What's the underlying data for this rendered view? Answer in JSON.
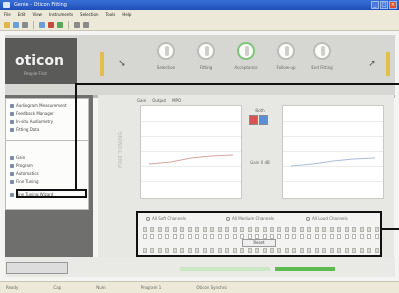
{
  "window": {
    "title": "Genie - Oticon Fitting",
    "controls": [
      "_",
      "□",
      "×"
    ]
  },
  "menu": [
    "File",
    "Edit",
    "View",
    "Instruments",
    "Selection",
    "Tools",
    "Help"
  ],
  "toolbar_icons": [
    "open-icon",
    "save-icon",
    "print-icon",
    "help-icon",
    "left-ear-icon",
    "right-ear-icon",
    "back-icon",
    "forward-icon"
  ],
  "brand": {
    "logo": "oticon",
    "tagline": "People First"
  },
  "steps": [
    {
      "label": "Selection",
      "active": false
    },
    {
      "label": "Fitting",
      "active": false
    },
    {
      "label": "Acceptance",
      "active": true
    },
    {
      "label": "Follow-up",
      "active": false
    },
    {
      "label": "End Fitting",
      "active": false
    }
  ],
  "sidebar": {
    "top_items": [
      "Audiogram Measurement",
      "Feedback Manager",
      "In-situ Audiometry",
      "Fitting Data"
    ],
    "bottom_items": [
      "Gain",
      "Program",
      "Automatics",
      "Fine Tuning",
      "Fine Tuning Wizard"
    ],
    "highlighted": "Fine Tuning Wizard"
  },
  "main": {
    "vertical_title": "FINE TUNING",
    "tabs": [
      "Gain",
      "Output",
      "MPO"
    ],
    "center_labels": [
      "R",
      "L",
      "Both",
      "Gain 0 dB"
    ]
  },
  "sliders": {
    "channels": [
      "All Soft Channels",
      "All Medium Channels",
      "All Loud Channels"
    ],
    "button": "Reset"
  },
  "status": [
    "Ready",
    "Cap",
    "Num",
    "Program 1",
    "Oticon Synchro"
  ],
  "colors": {
    "accent_green": "#5cba4e",
    "active_step": "#7fc47a",
    "right_ear": "#d9534f",
    "left_ear": "#5b8fd1"
  }
}
